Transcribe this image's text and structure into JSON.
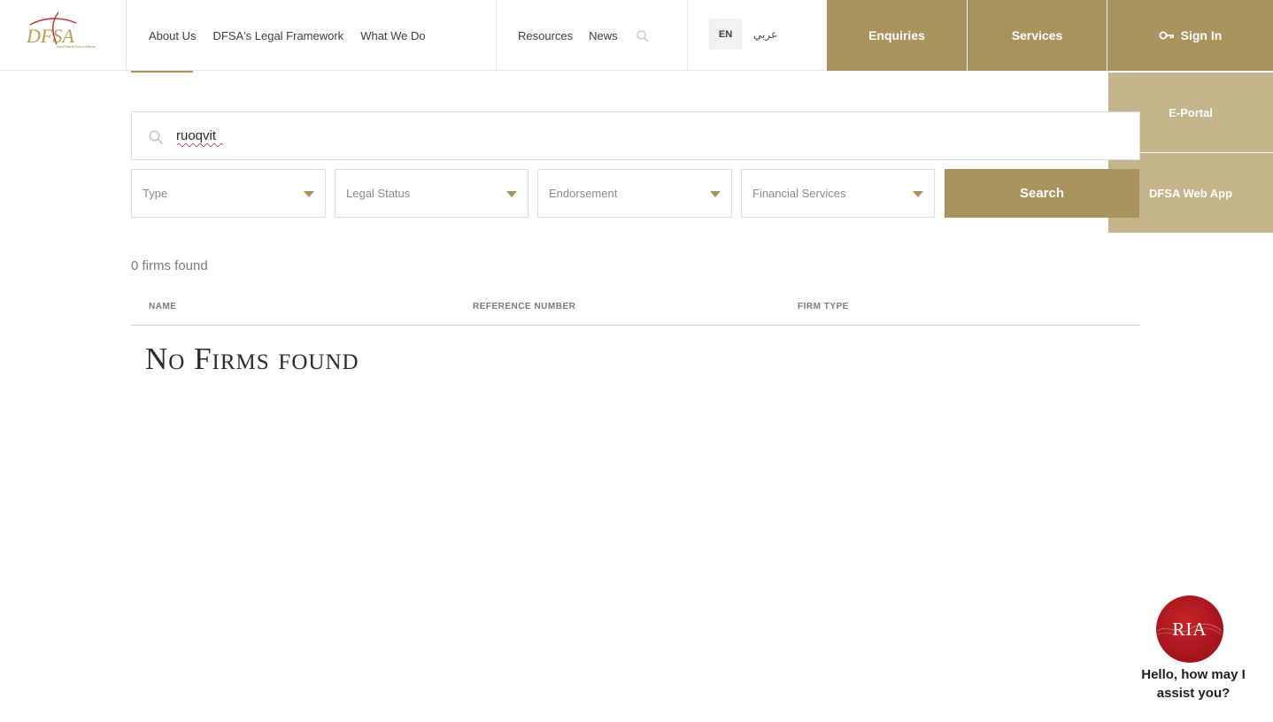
{
  "header": {
    "logo_alt": "DFSA",
    "logo_text": "DFSA",
    "logo_subtitle": "Dubai Financial Services Authority",
    "nav_main": [
      "About Us",
      "DFSA's Legal Framework",
      "What We Do"
    ],
    "nav_secondary": [
      "Resources",
      "News"
    ],
    "lang_en": "EN",
    "lang_ar": "عربي",
    "enquiries_label": "Enquiries",
    "services_label": "Services",
    "signin_label": "Sign In"
  },
  "signin_menu": [
    "E-Portal",
    "DFSA Web App"
  ],
  "search": {
    "value": "ruoqvit"
  },
  "filters": {
    "type": "Type",
    "legal_status": "Legal Status",
    "endorsement": "Endorsement",
    "financial_services": "Financial Services",
    "search_button": "Search"
  },
  "results": {
    "count_text": "0 firms found",
    "columns": [
      "NAME",
      "REFERENCE NUMBER",
      "FIRM TYPE"
    ],
    "empty_message": "No Firms found"
  },
  "chat": {
    "badge": "RIA",
    "greeting": "Hello, how may I assist you?"
  },
  "colors": {
    "gold": "#a9935c",
    "gold_light": "#c4b58a",
    "chat_red": "#a5121a"
  }
}
